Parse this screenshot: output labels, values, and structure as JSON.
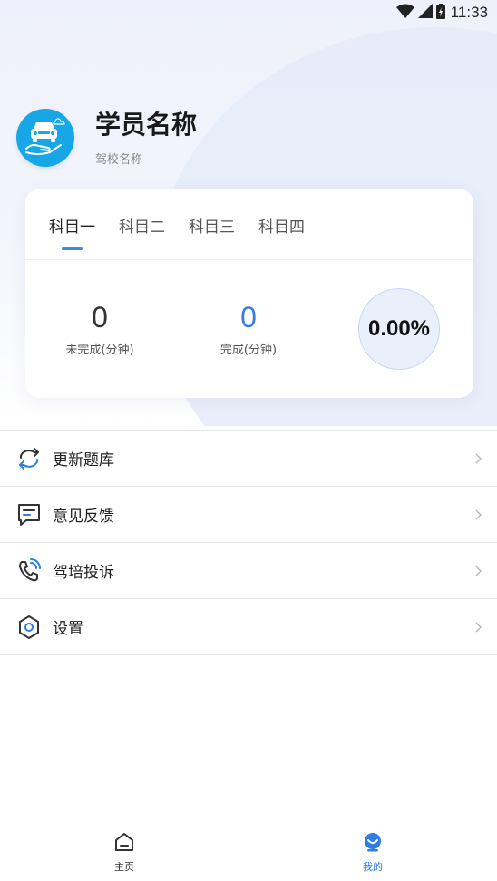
{
  "status_bar": {
    "time": "11:33",
    "icons": [
      "wifi-icon",
      "signal-icon",
      "battery-icon"
    ]
  },
  "profile": {
    "name": "学员名称",
    "school": "驾校名称",
    "avatar_icon": "car-hand-icon"
  },
  "subjects": {
    "tabs": [
      {
        "label": "科目一",
        "active": true
      },
      {
        "label": "科目二",
        "active": false
      },
      {
        "label": "科目三",
        "active": false
      },
      {
        "label": "科目四",
        "active": false
      }
    ],
    "incomplete": {
      "value": "0",
      "label": "未完成(分钟)"
    },
    "complete": {
      "value": "0",
      "label": "完成(分钟)"
    },
    "progress": "0.00%"
  },
  "menu": [
    {
      "label": "更新题库",
      "icon": "refresh-icon"
    },
    {
      "label": "意见反馈",
      "icon": "feedback-icon"
    },
    {
      "label": "驾培投诉",
      "icon": "phone-complaint-icon"
    },
    {
      "label": "设置",
      "icon": "settings-icon"
    }
  ],
  "tabbar": [
    {
      "label": "主页",
      "icon": "home-icon",
      "active": false
    },
    {
      "label": "我的",
      "icon": "profile-icon",
      "active": true
    }
  ],
  "colors": {
    "accent": "#3a8be8",
    "avatar_bg": "#18a7e6",
    "complete_value": "#3a7be0"
  }
}
